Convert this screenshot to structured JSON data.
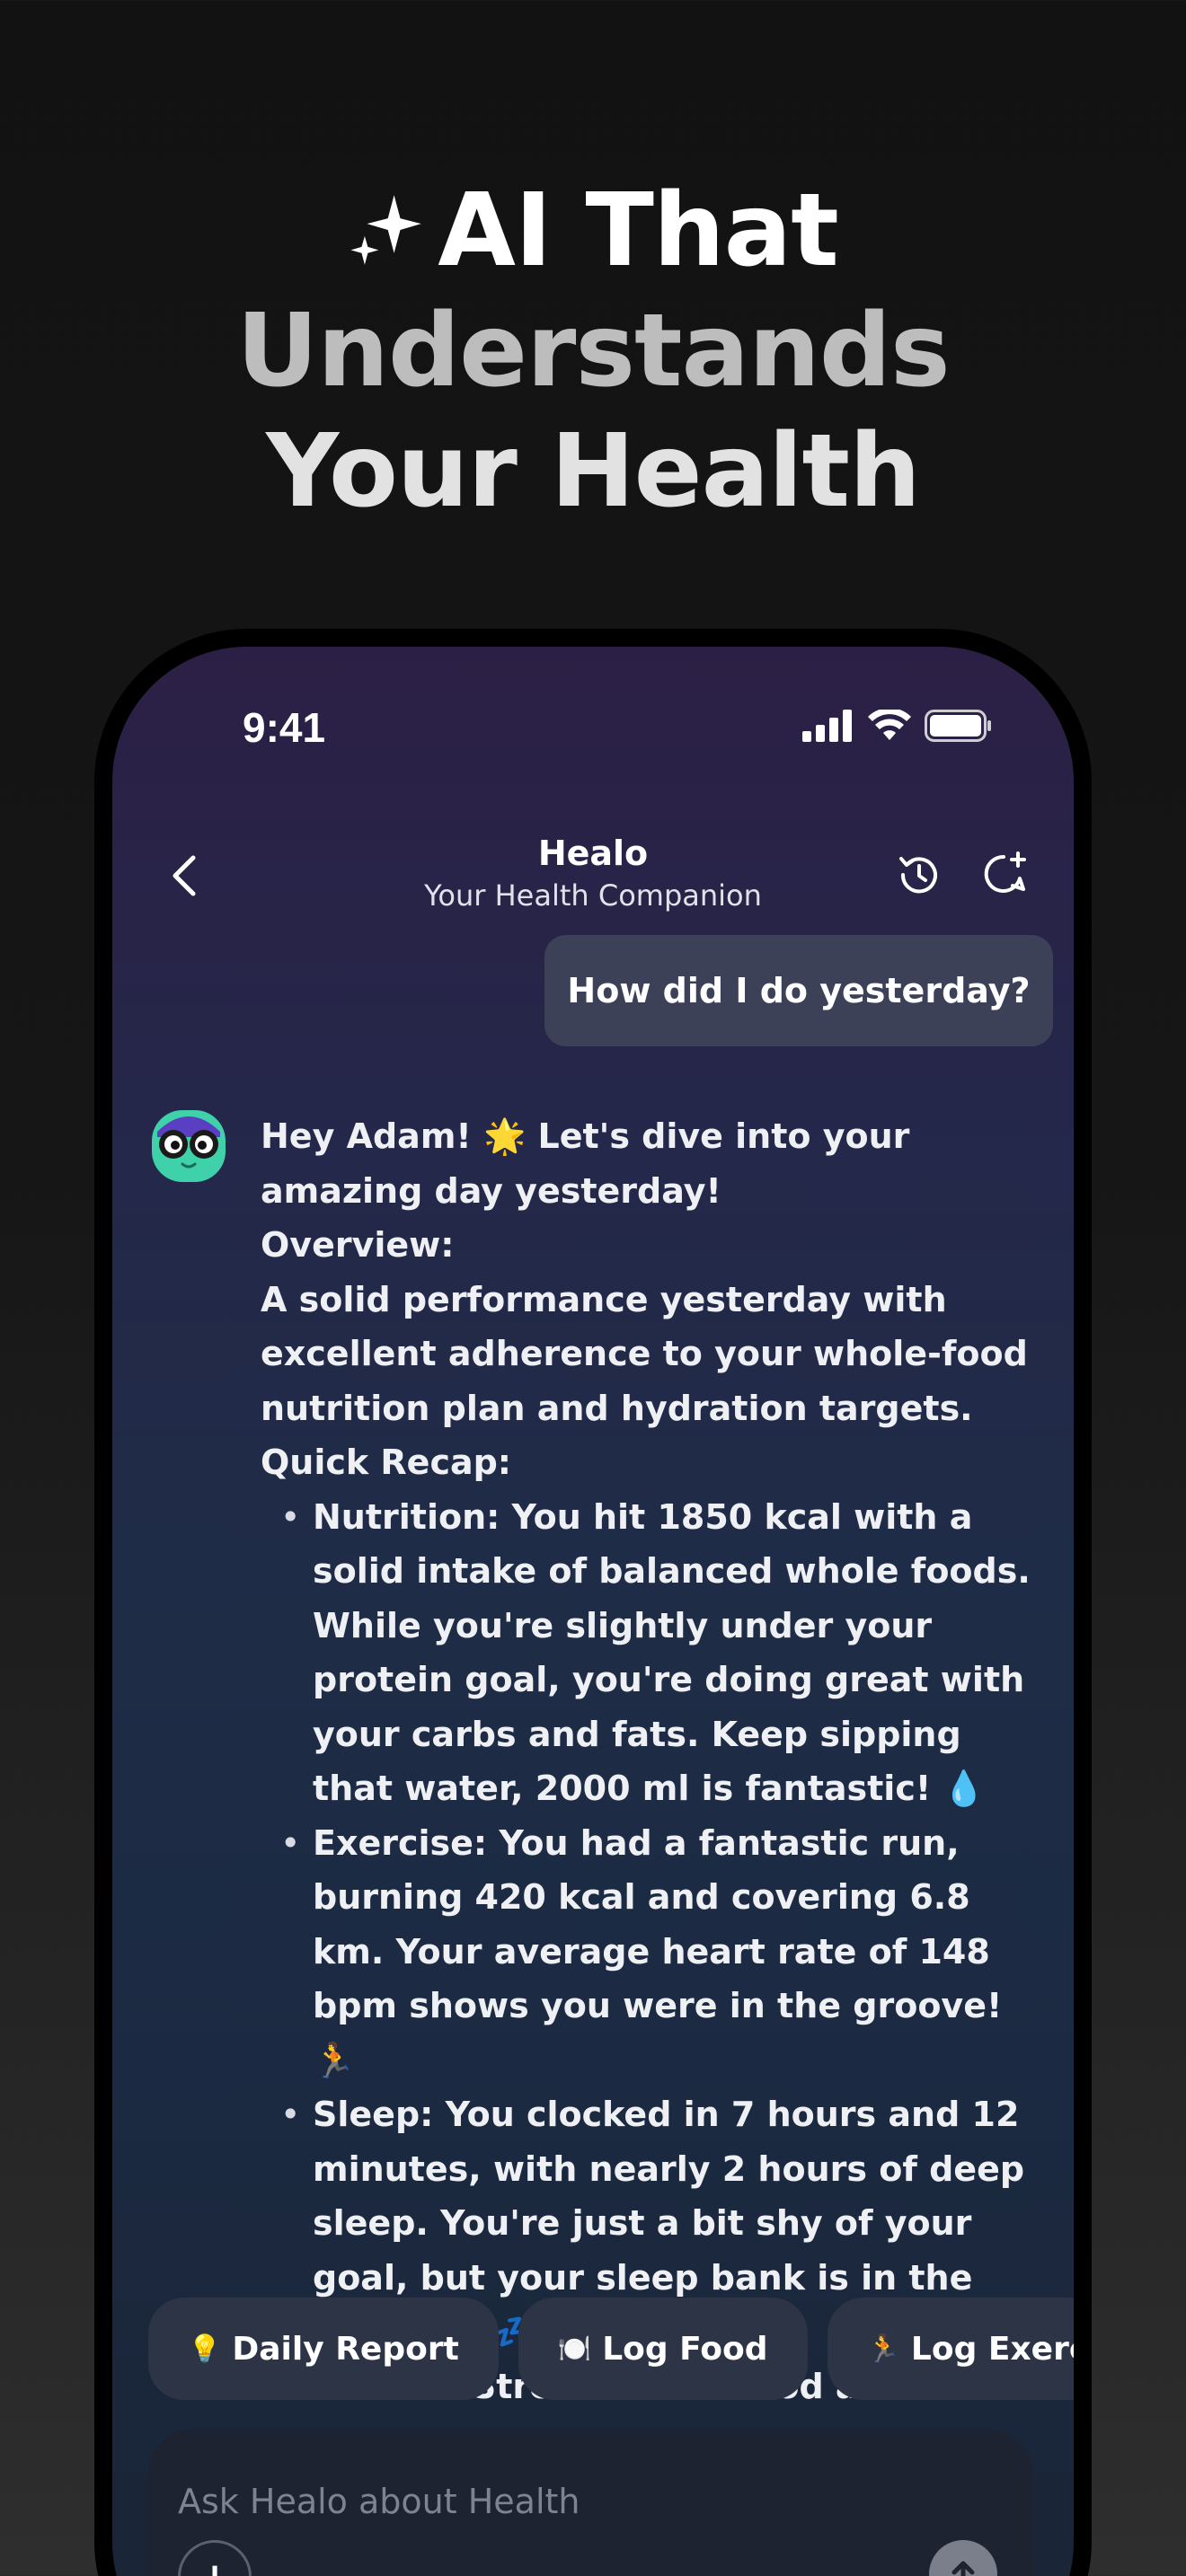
{
  "headline": {
    "line1": "AI That",
    "line2": "Understands",
    "line3": "Your Health"
  },
  "status_bar": {
    "time": "9:41"
  },
  "header": {
    "title": "Healo",
    "subtitle": "Your Health Companion"
  },
  "chat": {
    "user_message": "How did I do yesterday?",
    "assistant": {
      "greeting": "Hey Adam! 🌟 Let's dive into your amazing day yesterday!",
      "overview_heading": "Overview:",
      "overview_text": "A solid performance yesterday with excellent adherence to your whole-food nutrition plan and hydration targets.",
      "recap_heading": "Quick Recap:",
      "bullets": [
        "Nutrition: You hit 1850 kcal with a solid intake of balanced whole foods. While you're slightly under your protein goal, you're doing great with your carbs and fats. Keep sipping that water, 2000 ml is fantastic! 💧",
        "Exercise: You had a fantastic run, burning 420 kcal and covering 6.8 km. Your average heart rate of 148 bpm shows you were in the groove! 🏃",
        "Sleep: You clocked in 7 hours and 12 minutes, with nearly 2 hours of deep sleep. You're just a bit shy of your goal, but your sleep bank is in the positive! 💤",
        "Mood & Stress: Your mood and stress"
      ]
    }
  },
  "quick_actions": [
    {
      "icon": "💡",
      "label": "Daily Report"
    },
    {
      "icon": "🍽️",
      "label": "Log Food"
    },
    {
      "icon": "🏃",
      "label": "Log Exercise"
    }
  ],
  "composer": {
    "placeholder": "Ask Healo about Health"
  }
}
